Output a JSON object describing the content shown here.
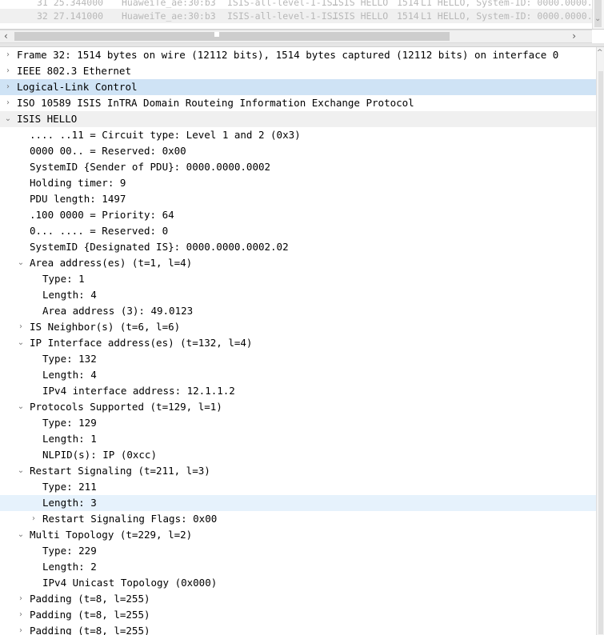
{
  "packet_list": {
    "rows": [
      {
        "time": "31 25.344000",
        "source": "HuaweiTe_ae:30:b3",
        "destination": "ISIS-all-level-1-IS…",
        "protocol": "ISIS HELLO",
        "length": "1514",
        "info": "L1 HELLO, System-ID: 0000.0000.0"
      },
      {
        "time": "32 27.141000",
        "source": "HuaweiTe_ae:30:b3",
        "destination": "ISIS-all-level-1-IS…",
        "protocol": "ISIS HELLO",
        "length": "1514",
        "info": "L1 HELLO, System-ID: 0000.0000.0"
      }
    ]
  },
  "icons": {
    "collapsed": "›",
    "expanded": "⌄",
    "scroll_left": "‹",
    "scroll_right": "›",
    "scroll_up": "^",
    "scroll_down": "⌄"
  },
  "tree": [
    {
      "text": "Frame 32: 1514 bytes on wire (12112 bits), 1514 bytes captured (12112 bits) on interface 0",
      "level": 0,
      "arrow": "collapsed",
      "state": ""
    },
    {
      "text": "IEEE 802.3 Ethernet",
      "level": 0,
      "arrow": "collapsed",
      "state": ""
    },
    {
      "text": "Logical-Link Control",
      "level": 0,
      "arrow": "collapsed",
      "state": "selected"
    },
    {
      "text": "ISO 10589 ISIS InTRA Domain Routeing Information Exchange Protocol",
      "level": 0,
      "arrow": "collapsed",
      "state": ""
    },
    {
      "text": "ISIS HELLO",
      "level": 0,
      "arrow": "expanded",
      "state": "gray"
    },
    {
      "text": ".... ..11 = Circuit type: Level 1 and 2 (0x3)",
      "level": 1,
      "arrow": "none",
      "state": ""
    },
    {
      "text": "0000 00.. = Reserved: 0x00",
      "level": 1,
      "arrow": "none",
      "state": ""
    },
    {
      "text": "SystemID {Sender of PDU}: 0000.0000.0002",
      "level": 1,
      "arrow": "none",
      "state": ""
    },
    {
      "text": "Holding timer: 9",
      "level": 1,
      "arrow": "none",
      "state": ""
    },
    {
      "text": "PDU length: 1497",
      "level": 1,
      "arrow": "none",
      "state": ""
    },
    {
      "text": ".100 0000 = Priority: 64",
      "level": 1,
      "arrow": "none",
      "state": ""
    },
    {
      "text": "0... .... = Reserved: 0",
      "level": 1,
      "arrow": "none",
      "state": ""
    },
    {
      "text": "SystemID {Designated IS}: 0000.0000.0002.02",
      "level": 1,
      "arrow": "none",
      "state": ""
    },
    {
      "text": "Area address(es) (t=1, l=4)",
      "level": 1,
      "arrow": "expanded",
      "state": ""
    },
    {
      "text": "Type: 1",
      "level": 2,
      "arrow": "none",
      "state": ""
    },
    {
      "text": "Length: 4",
      "level": 2,
      "arrow": "none",
      "state": ""
    },
    {
      "text": "Area address (3): 49.0123",
      "level": 2,
      "arrow": "none",
      "state": ""
    },
    {
      "text": "IS Neighbor(s) (t=6, l=6)",
      "level": 1,
      "arrow": "collapsed",
      "state": ""
    },
    {
      "text": "IP Interface address(es) (t=132, l=4)",
      "level": 1,
      "arrow": "expanded",
      "state": ""
    },
    {
      "text": "Type: 132",
      "level": 2,
      "arrow": "none",
      "state": ""
    },
    {
      "text": "Length: 4",
      "level": 2,
      "arrow": "none",
      "state": ""
    },
    {
      "text": "IPv4 interface address: 12.1.1.2",
      "level": 2,
      "arrow": "none",
      "state": ""
    },
    {
      "text": "Protocols Supported (t=129, l=1)",
      "level": 1,
      "arrow": "expanded",
      "state": ""
    },
    {
      "text": "Type: 129",
      "level": 2,
      "arrow": "none",
      "state": ""
    },
    {
      "text": "Length: 1",
      "level": 2,
      "arrow": "none",
      "state": ""
    },
    {
      "text": "NLPID(s): IP (0xcc)",
      "level": 2,
      "arrow": "none",
      "state": ""
    },
    {
      "text": "Restart Signaling (t=211, l=3)",
      "level": 1,
      "arrow": "expanded",
      "state": ""
    },
    {
      "text": "Type: 211",
      "level": 2,
      "arrow": "none",
      "state": ""
    },
    {
      "text": "Length: 3",
      "level": 2,
      "arrow": "none",
      "state": "hover"
    },
    {
      "text": "Restart Signaling Flags: 0x00",
      "level": 2,
      "arrow": "collapsed",
      "state": ""
    },
    {
      "text": "Multi Topology (t=229, l=2)",
      "level": 1,
      "arrow": "expanded",
      "state": ""
    },
    {
      "text": "Type: 229",
      "level": 2,
      "arrow": "none",
      "state": ""
    },
    {
      "text": "Length: 2",
      "level": 2,
      "arrow": "none",
      "state": ""
    },
    {
      "text": "IPv4 Unicast Topology (0x000)",
      "level": 2,
      "arrow": "none",
      "state": ""
    },
    {
      "text": "Padding (t=8, l=255)",
      "level": 1,
      "arrow": "collapsed",
      "state": ""
    },
    {
      "text": "Padding (t=8, l=255)",
      "level": 1,
      "arrow": "collapsed",
      "state": ""
    },
    {
      "text": "Padding (t=8, l=255)",
      "level": 1,
      "arrow": "collapsed",
      "state": ""
    }
  ]
}
